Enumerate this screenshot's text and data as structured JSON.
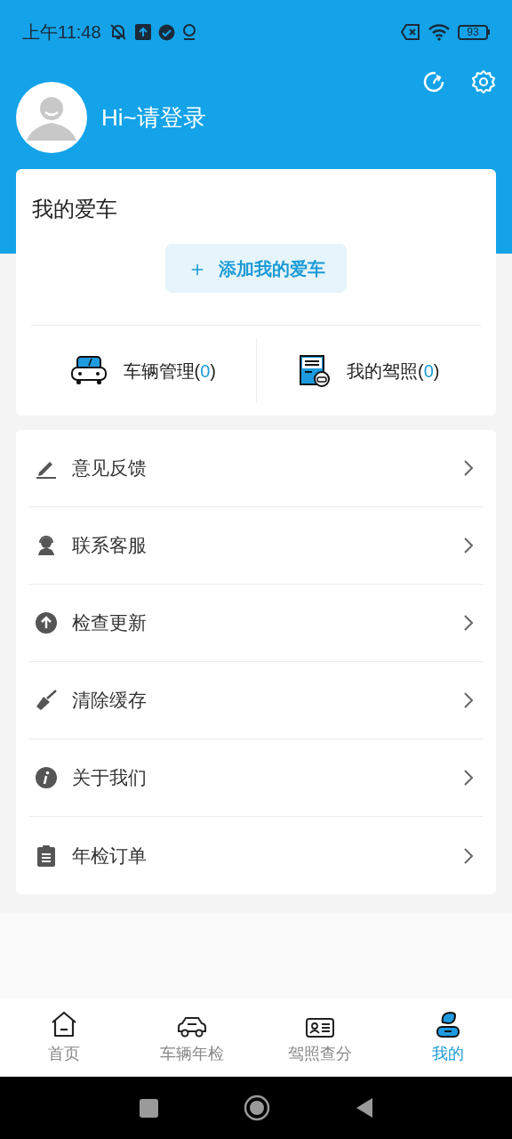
{
  "status_bar": {
    "time": "上午11:48",
    "battery": "93"
  },
  "profile": {
    "greeting": "Hi~请登录"
  },
  "my_car": {
    "title": "我的爱车",
    "add_button": "添加我的爱车",
    "add_icon": "＋",
    "stats": [
      {
        "kind": "car",
        "label": "车辆管理(",
        "count": "0",
        "close": ")"
      },
      {
        "kind": "license",
        "label": "我的驾照(",
        "count": "0",
        "close": ")"
      }
    ]
  },
  "menu": [
    {
      "kind": "feedback",
      "label": "意见反馈"
    },
    {
      "kind": "service",
      "label": "联系客服"
    },
    {
      "kind": "update",
      "label": "检查更新"
    },
    {
      "kind": "clean",
      "label": "清除缓存"
    },
    {
      "kind": "about",
      "label": "关于我们"
    },
    {
      "kind": "orders",
      "label": "年检订单"
    }
  ],
  "tabs": [
    {
      "kind": "home",
      "label": "首页",
      "selected": false
    },
    {
      "kind": "car",
      "label": "车辆年检",
      "selected": false
    },
    {
      "kind": "card",
      "label": "驾照查分",
      "selected": false
    },
    {
      "kind": "me",
      "label": "我的",
      "selected": true
    }
  ]
}
